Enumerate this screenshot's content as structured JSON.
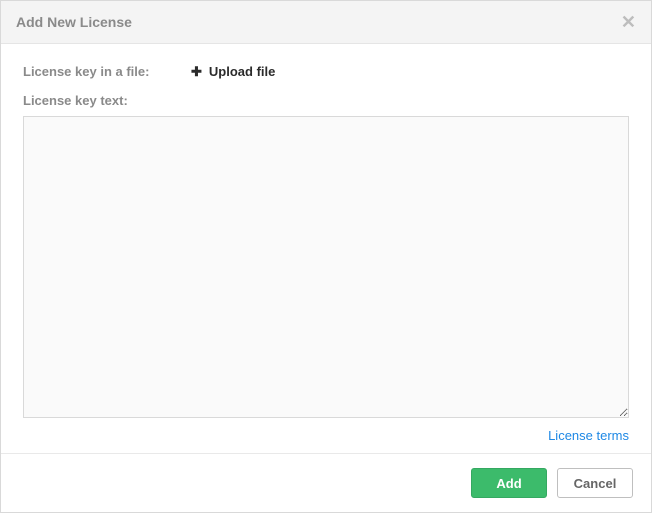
{
  "dialog": {
    "title": "Add New License",
    "close_icon": "✕"
  },
  "fileRow": {
    "label": "License key in a file:",
    "uploadLabel": "Upload file",
    "plus": "✚"
  },
  "textRow": {
    "label": "License key text:",
    "value": ""
  },
  "termsLink": "License terms",
  "footer": {
    "add": "Add",
    "cancel": "Cancel"
  }
}
